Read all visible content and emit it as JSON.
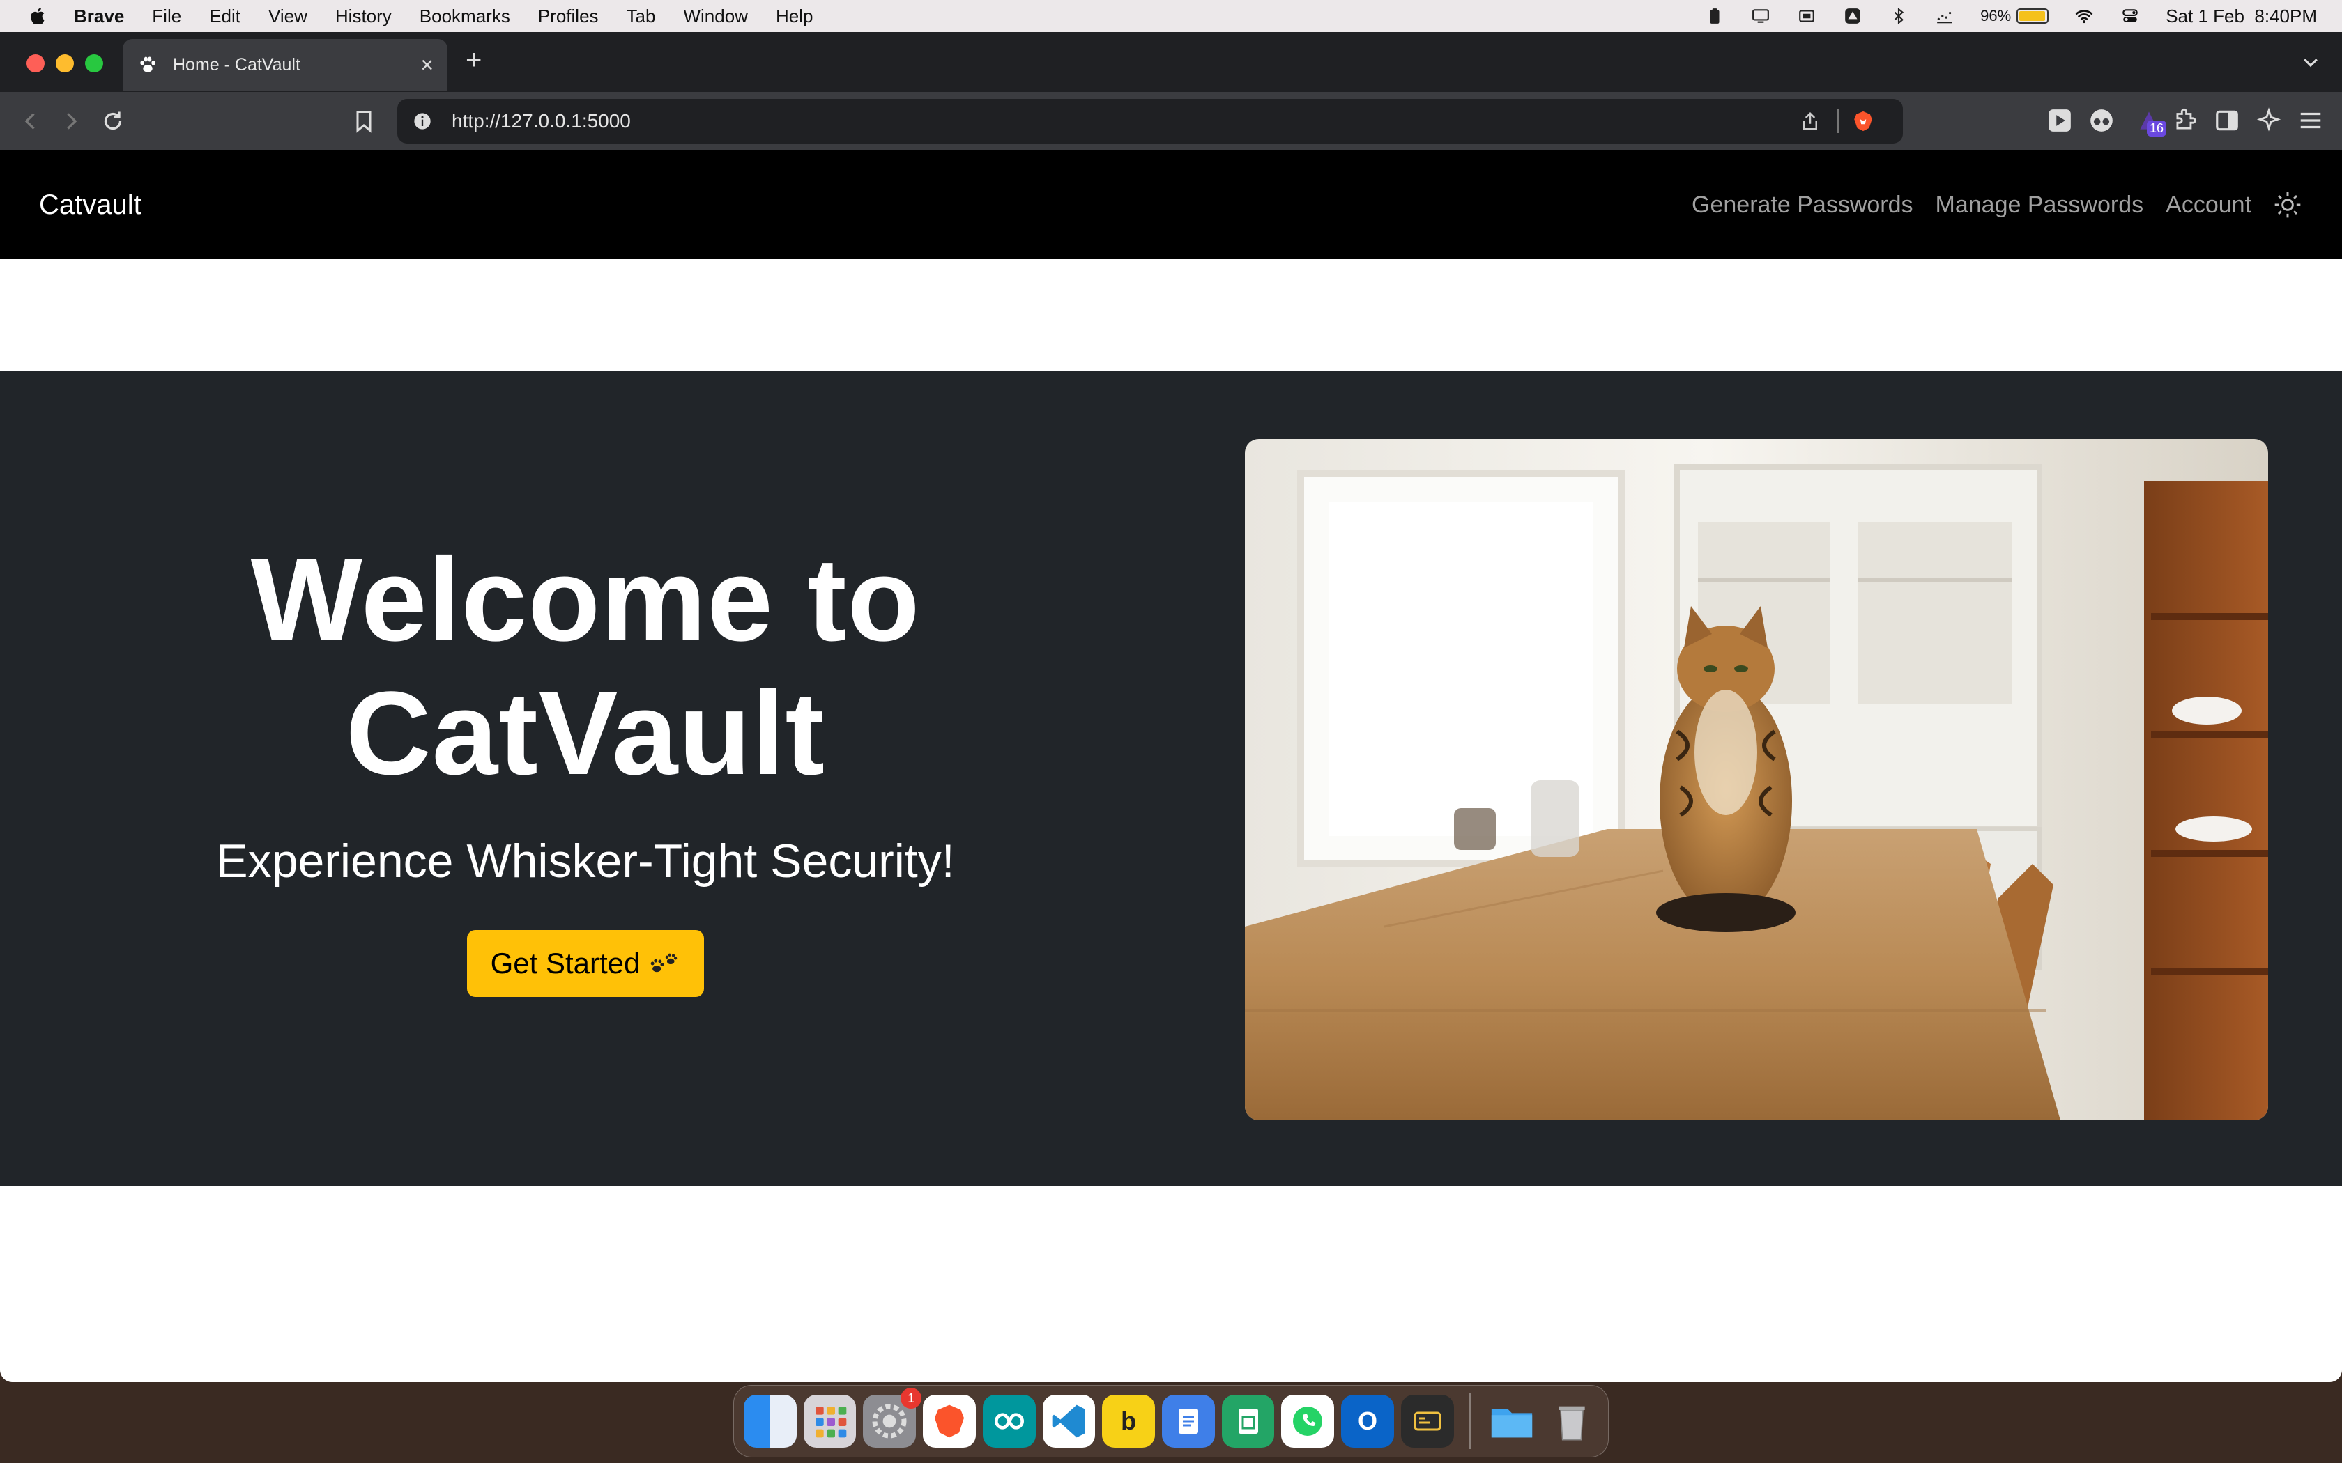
{
  "menubar": {
    "app": "Brave",
    "items": [
      "File",
      "Edit",
      "View",
      "History",
      "Bookmarks",
      "Profiles",
      "Tab",
      "Window",
      "Help"
    ],
    "battery_percent": "96%",
    "battery_level": 0.96,
    "datetime": "Sat 1 Feb  8:40PM"
  },
  "browser": {
    "tab_title": "Home - CatVault",
    "url": "http://127.0.0.1:5000",
    "extension_badge": "16"
  },
  "page": {
    "brand": "Catvault",
    "nav": [
      "Generate Passwords",
      "Manage Passwords",
      "Account"
    ],
    "hero": {
      "title_line1": "Welcome to",
      "title_line2": "CatVault",
      "subtitle": "Experience Whisker-Tight Security!",
      "cta": "Get Started",
      "image_alt": "Bengal cat sitting on a wooden kitchen table"
    }
  },
  "dock": {
    "apps": [
      "finder-icon",
      "launchpad-icon",
      "system-settings-icon",
      "brave-icon",
      "arduino-icon",
      "vscode-icon",
      "bing-icon",
      "google-docs-icon",
      "google-sheets-icon",
      "whatsapp-icon",
      "outlook-icon",
      "terminal-icon",
      "folder-icon",
      "trash-icon"
    ],
    "settings_badge": "1"
  },
  "colors": {
    "navbar": "#000000",
    "hero_bg": "#212529",
    "cta": "#ffc107",
    "browser_chrome": "#1f2023",
    "toolbar": "#3b3c40"
  }
}
